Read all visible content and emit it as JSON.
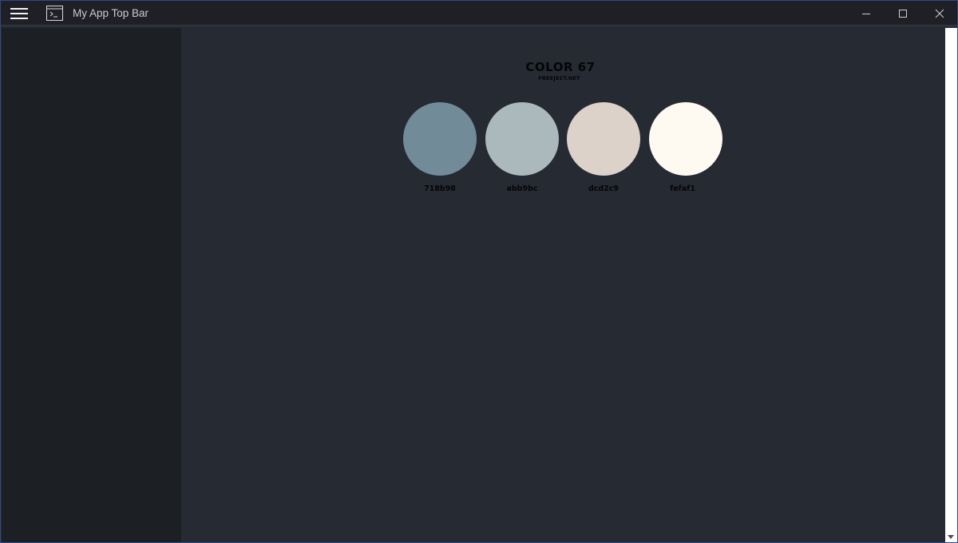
{
  "titlebar": {
    "title": "My App Top Bar",
    "menu_icon": "hamburger-menu-icon",
    "app_icon": "terminal-window-icon",
    "controls": [
      "minimize-icon",
      "maximize-icon",
      "close-icon"
    ]
  },
  "palette": {
    "title": "COLOR 67",
    "subtitle": "FREEJECT.NET",
    "swatches": [
      {
        "code": "718b98",
        "color": "#718b98"
      },
      {
        "code": "abb9bc",
        "color": "#abb9bc"
      },
      {
        "code": "dcd2c9",
        "color": "#dcd2c9"
      },
      {
        "code": "fefaf1",
        "color": "#fefaf1"
      }
    ]
  },
  "colors": {
    "titlebar_bg": "#1e2026",
    "sidebar_bg": "#1c1f23",
    "main_bg": "#262a33",
    "window_border": "#2c4a8a"
  }
}
